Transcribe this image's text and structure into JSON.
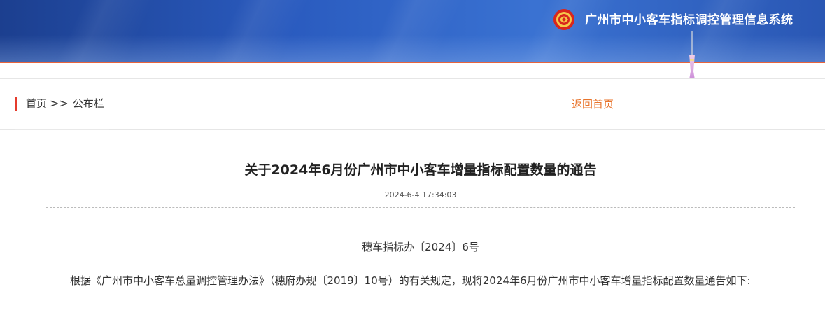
{
  "header": {
    "system_title": "广州市中小客车指标调控管理信息系统",
    "logo_icon": "guangzhou-emblem-icon",
    "accent_color": "#e53b2c"
  },
  "breadcrumb": {
    "home": "首页",
    "separator": ">>",
    "current": "公布栏",
    "back_link": "返回首页"
  },
  "article": {
    "title": "关于2024年6月份广州市中小客车增量指标配置数量的通告",
    "date": "2024-6-4 17:34:03",
    "doc_number": "穗车指标办〔2024〕6号",
    "paragraph": "根据《广州市中小客车总量调控管理办法》（穗府办规〔2019〕10号）的有关规定，现将2024年6月份广州市中小客车增量指标配置数量通告如下:"
  }
}
